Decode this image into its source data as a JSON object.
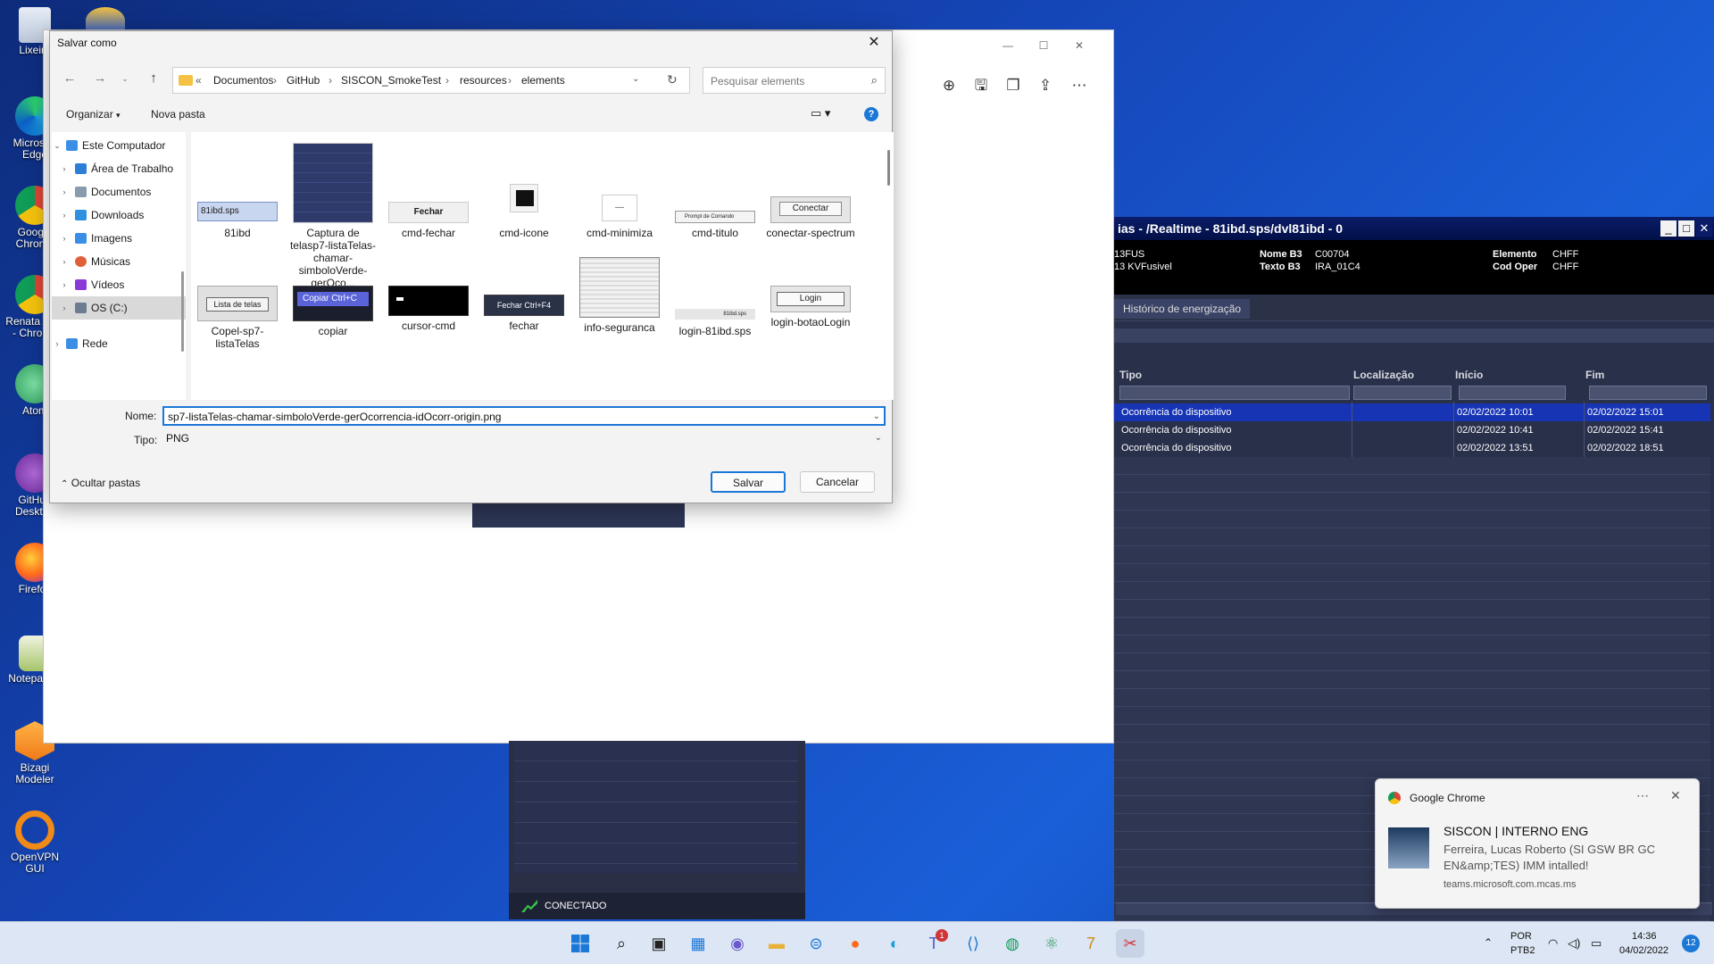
{
  "desktop": {
    "icons": [
      {
        "label": "Lixeira"
      },
      {
        "label": "Microsoft Edge"
      },
      {
        "label": "Google Chrome"
      },
      {
        "label": "Renata A de - Chrome"
      },
      {
        "label": "Atom"
      },
      {
        "label": "GitHub Desktop"
      },
      {
        "label": "Firefox"
      },
      {
        "label": "Notepad++"
      },
      {
        "label": "Bizagi Modeler"
      },
      {
        "label": "OpenVPN GUI"
      }
    ]
  },
  "viewer": {
    "toolbar": [
      "zoom-in-icon",
      "save-icon",
      "copy-icon",
      "share-icon",
      "more-icon"
    ]
  },
  "darkapp": {
    "title": "ias - /Realtime - 81ibd.sps/dvl81ibd - 0",
    "info": {
      "left1": "13FUS",
      "left2": "13 KVFusivel",
      "nome_b3_label": "Nome B3",
      "nome_b3_value": "C00704",
      "texto_b3_label": "Texto B3",
      "texto_b3_value": "IRA_01C4",
      "elemento_label": "Elemento",
      "elemento_value": "CHFF",
      "cod_oper_label": "Cod Oper",
      "cod_oper_value": "CHFF"
    },
    "tab": "Histórico de energização",
    "columns": [
      "Tipo",
      "Localização",
      "Início",
      "Fim"
    ],
    "rows": [
      {
        "tipo": "Ocorrência do dispositivo",
        "local": "",
        "inicio": "02/02/2022 10:01",
        "fim": "02/02/2022 15:01"
      },
      {
        "tipo": "Ocorrência do dispositivo",
        "local": "",
        "inicio": "02/02/2022 10:41",
        "fim": "02/02/2022 15:41"
      },
      {
        "tipo": "Ocorrência do dispositivo",
        "local": "",
        "inicio": "02/02/2022 13:51",
        "fim": "02/02/2022 18:51"
      }
    ],
    "status": "CONECTADO"
  },
  "dialog": {
    "title": "Salvar como",
    "breadcrumb": [
      "Documentos",
      "GitHub",
      "SISCON_SmokeTest",
      "resources",
      "elements"
    ],
    "search_placeholder": "Pesquisar elements",
    "organize": "Organizar",
    "new_folder": "Nova pasta",
    "nav": [
      {
        "label": "Este Computador",
        "level": 0,
        "expanded": true,
        "color": "#3a8ee6"
      },
      {
        "label": "Área de Trabalho",
        "level": 1,
        "color": "#2d7fd6"
      },
      {
        "label": "Documentos",
        "level": 1,
        "color": "#8a9bb0"
      },
      {
        "label": "Downloads",
        "level": 1,
        "color": "#2f8fe0"
      },
      {
        "label": "Imagens",
        "level": 1,
        "color": "#3a8ee6"
      },
      {
        "label": "Músicas",
        "level": 1,
        "color": "#e0603a"
      },
      {
        "label": "Vídeos",
        "level": 1,
        "color": "#8a3ad6"
      },
      {
        "label": "OS (C:)",
        "level": 1,
        "color": "#6d7c8f",
        "selected": true
      },
      {
        "label": "Rede",
        "level": 0,
        "color": "#3a8ee6"
      }
    ],
    "files": [
      {
        "label": "81ibd",
        "thumb_text": "81ibd.sps"
      },
      {
        "label": "Captura de telasp7-listaTelas-chamar-simboloVerde-gerOco...",
        "thumb_text": ""
      },
      {
        "label": "cmd-fechar",
        "thumb_text": "Fechar"
      },
      {
        "label": "cmd-icone",
        "thumb_text": ""
      },
      {
        "label": "cmd-minimiza",
        "thumb_text": ""
      },
      {
        "label": "cmd-titulo",
        "thumb_text": "Prompt de Comando"
      },
      {
        "label": "conectar-spectrum",
        "thumb_text": "Conectar"
      },
      {
        "label": "Copel-sp7-listaTelas",
        "thumb_text": "Lista de telas"
      },
      {
        "label": "copiar",
        "thumb_text": "Copiar Ctrl+C"
      },
      {
        "label": "cursor-cmd",
        "thumb_text": ""
      },
      {
        "label": "fechar",
        "thumb_text": "Fechar Ctrl+F4"
      },
      {
        "label": "info-seguranca",
        "thumb_text": ""
      },
      {
        "label": "login-81ibd.sps",
        "thumb_text": "81ibd.sps"
      },
      {
        "label": "login-botaoLogin",
        "thumb_text": "Login"
      }
    ],
    "name_label": "Nome:",
    "name_value": "sp7-listaTelas-chamar-simboloVerde-gerOcorrencia-idOcorr-origin.png",
    "type_label": "Tipo:",
    "type_value": "PNG",
    "hide_folders": "Ocultar pastas",
    "save": "Salvar",
    "cancel": "Cancelar"
  },
  "toast": {
    "app": "Google Chrome",
    "title": "SISCON | INTERNO ENG",
    "body": "Ferreira, Lucas Roberto (SI GSW BR GC EN&amp;TES) IMM intalled!",
    "source": "teams.microsoft.com.mcas.ms"
  },
  "tray": {
    "lang1": "POR",
    "lang2": "PTB2",
    "time": "14:36",
    "date": "04/02/2022",
    "badge": "12",
    "teams_badge": "1"
  }
}
